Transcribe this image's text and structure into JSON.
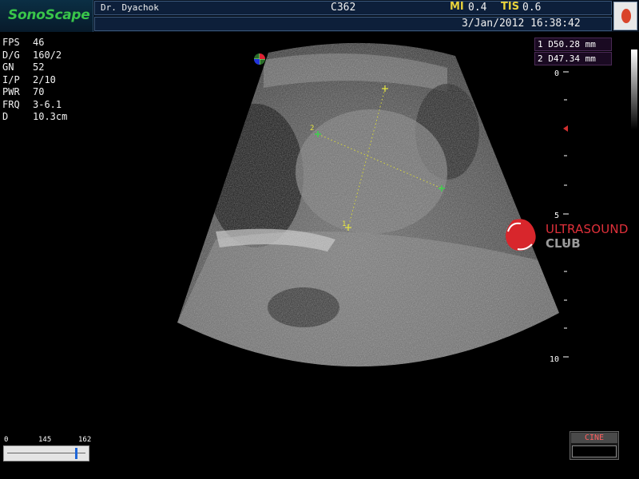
{
  "header": {
    "logo": "SonoScape",
    "doctor": "Dr. Dyachok",
    "probe": "C362",
    "mi_label": "MI",
    "mi_value": "0.4",
    "tis_label": "TIS",
    "tis_value": "0.6",
    "datetime": "3/Jan/2012 16:38:42"
  },
  "params": [
    {
      "label": "FPS",
      "value": "46"
    },
    {
      "label": "D/G",
      "value": "160/2"
    },
    {
      "label": "GN",
      "value": "52"
    },
    {
      "label": "I/P",
      "value": "2/10"
    },
    {
      "label": "PWR",
      "value": "70"
    },
    {
      "label": "FRQ",
      "value": "3-6.1"
    },
    {
      "label": "D",
      "value": "10.3cm"
    }
  ],
  "measurements": [
    {
      "text": "1 D50.28 mm"
    },
    {
      "text": "2 D47.34 mm"
    }
  ],
  "depth_scale": {
    "labels": [
      "0",
      "5",
      "10"
    ]
  },
  "caliper_labels": {
    "one": "1",
    "two": "2"
  },
  "slider": {
    "min": "0",
    "mid": "145",
    "max": "162"
  },
  "cine": {
    "label": "CINE"
  },
  "watermark": {
    "line1": "ULTRASOUND",
    "line2": "CLUB"
  },
  "colors": {
    "logo": "#39c54a",
    "accent_yellow": "#e8d23a",
    "caliper_green": "#3ad24a",
    "header_bg": "#0d1f3a"
  }
}
